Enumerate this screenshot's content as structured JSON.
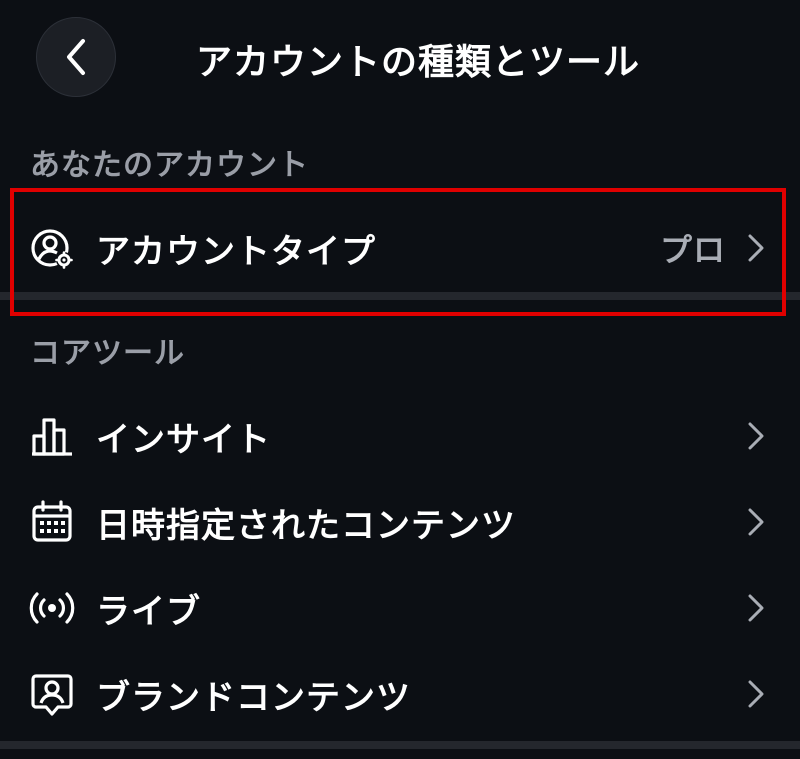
{
  "header": {
    "title": "アカウントの種類とツール",
    "back_icon": "chevron-left-icon"
  },
  "sections": {
    "your_account": {
      "title": "あなたのアカウント",
      "items": [
        {
          "label": "アカウントタイプ",
          "value": "プロ",
          "icon": "account-settings-icon"
        }
      ]
    },
    "core_tools": {
      "title": "コアツール",
      "items": [
        {
          "label": "インサイト",
          "icon": "bar-chart-icon"
        },
        {
          "label": "日時指定されたコンテンツ",
          "icon": "calendar-icon"
        },
        {
          "label": "ライブ",
          "icon": "live-broadcast-icon"
        },
        {
          "label": "ブランドコンテンツ",
          "icon": "branded-content-icon"
        }
      ]
    }
  },
  "colors": {
    "background": "#0c0f14",
    "section_title": "#9a9ea7",
    "highlight": "#e00000",
    "divider": "#24272d"
  }
}
